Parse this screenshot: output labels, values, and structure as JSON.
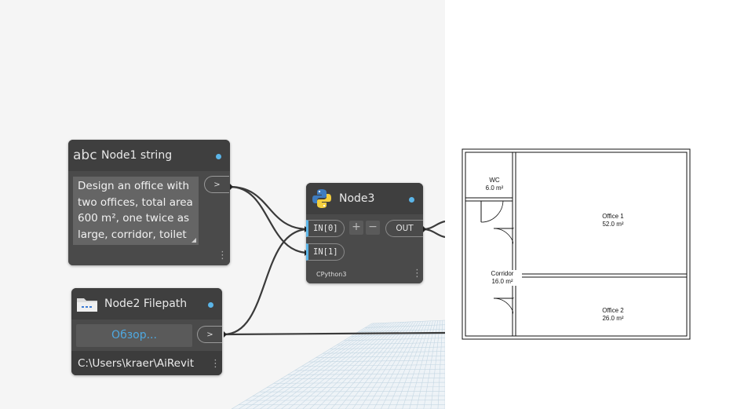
{
  "node1": {
    "icon_text": "abc",
    "title": "Node1 string",
    "text_lines": [
      "Design an office with",
      "two offices, total area",
      "600 m², one twice as",
      "large, corridor, toilet"
    ],
    "out_port": ">"
  },
  "node2": {
    "title": "Node2 Filepath",
    "browse_label": "Обзор...",
    "out_port": ">",
    "path": "C:\\Users\\kraer\\AiRevit"
  },
  "node3": {
    "title": "Node3",
    "inputs": [
      "IN[0]",
      "IN[1]"
    ],
    "add_label": "+",
    "remove_label": "−",
    "output": "OUT",
    "engine": "CPython3"
  },
  "floorplan": {
    "rooms": [
      {
        "name": "WC",
        "area": "6.0 m²"
      },
      {
        "name": "Office 1",
        "area": "52.0 m²"
      },
      {
        "name": "Corridor",
        "area": "16.0 m²"
      },
      {
        "name": "Office 2",
        "area": "26.0 m²"
      }
    ]
  },
  "colors": {
    "node_body": "#4a4a4a",
    "node_header": "#3f3f3f",
    "accent_blue": "#5bb5e8",
    "wire": "#3a3a3a"
  },
  "icons": {
    "node1": "abc-string-icon",
    "node2": "folder-icon",
    "node3": "python-icon",
    "menu": "kebab-menu-icon"
  }
}
